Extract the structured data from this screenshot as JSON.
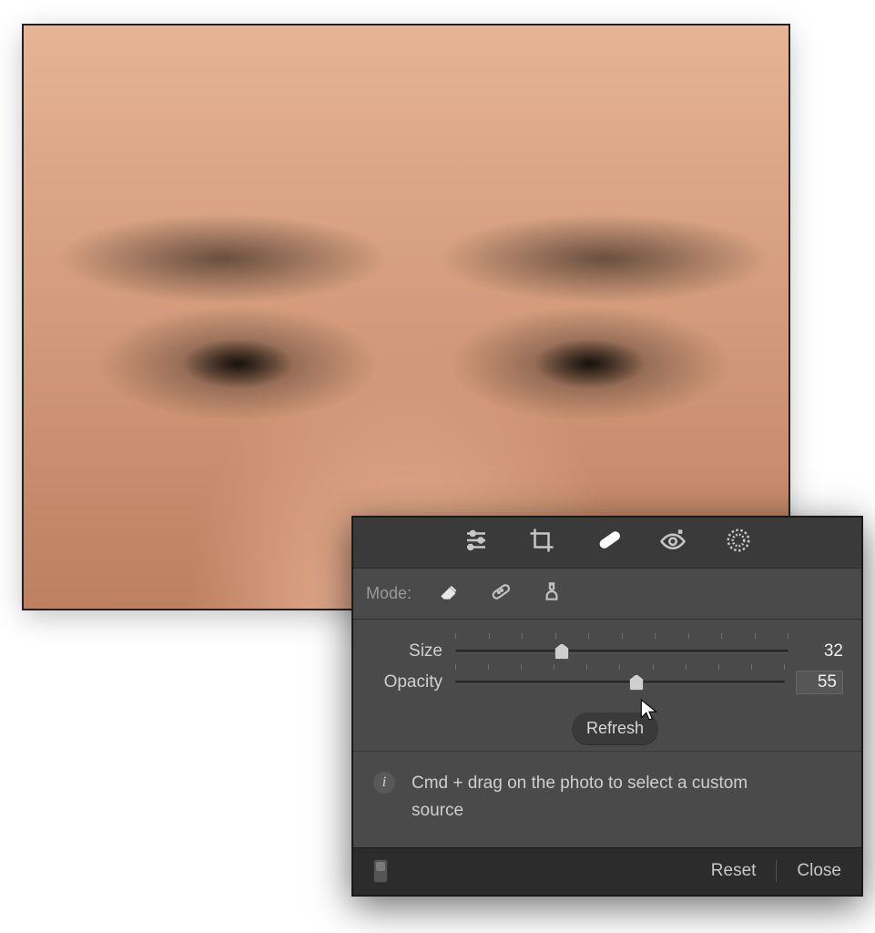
{
  "panel": {
    "mode_label": "Mode:",
    "tools": {
      "sliders": "adjust-sliders-icon",
      "crop": "crop-icon",
      "heal": "healing-brush-icon",
      "redeye": "red-eye-icon",
      "radial": "radial-filter-icon",
      "active": "heal"
    },
    "modes": {
      "eraser": "eraser-mode-icon",
      "heal": "heal-mode-icon",
      "clone": "clone-stamp-mode-icon",
      "active": "eraser"
    },
    "sliders": {
      "size": {
        "label": "Size",
        "value": 32,
        "min": 0,
        "max": 100
      },
      "opacity": {
        "label": "Opacity",
        "value": 55,
        "min": 0,
        "max": 100
      }
    },
    "refresh_label": "Refresh",
    "hint": "Cmd + drag on the photo to select a custom source",
    "footer": {
      "reset": "Reset",
      "close": "Close"
    }
  }
}
